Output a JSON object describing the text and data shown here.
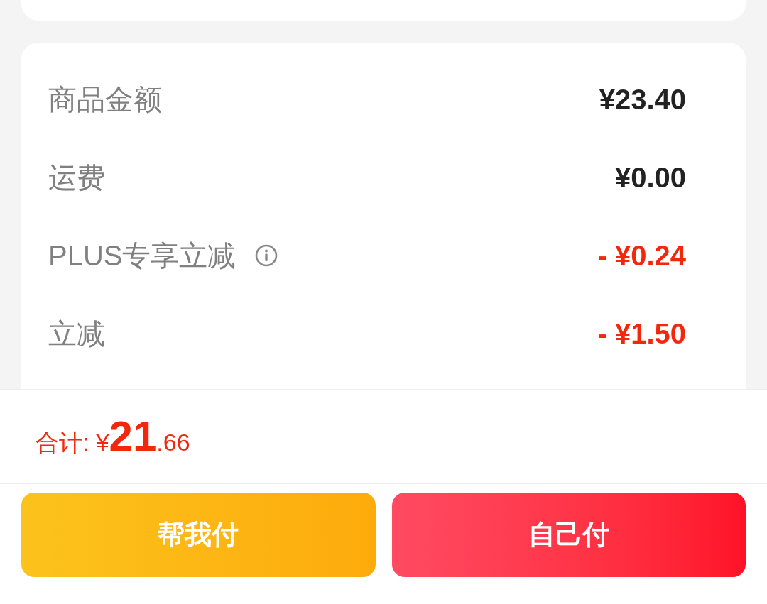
{
  "summary_rows": [
    {
      "label": "商品金额",
      "value": "¥23.40",
      "kind": "charge"
    },
    {
      "label": "运费",
      "value": "¥0.00",
      "kind": "charge"
    },
    {
      "label": "PLUS专享立减",
      "value": "- ¥0.24",
      "kind": "discount",
      "info": true
    },
    {
      "label": "立减",
      "value": "- ¥1.50",
      "kind": "discount"
    }
  ],
  "total": {
    "label": "合计:",
    "currency": "¥",
    "integer": "21",
    "decimal": ".66"
  },
  "buttons": [
    {
      "label": "帮我付",
      "kind": "secondary"
    },
    {
      "label": "自己付",
      "kind": "primary"
    }
  ]
}
